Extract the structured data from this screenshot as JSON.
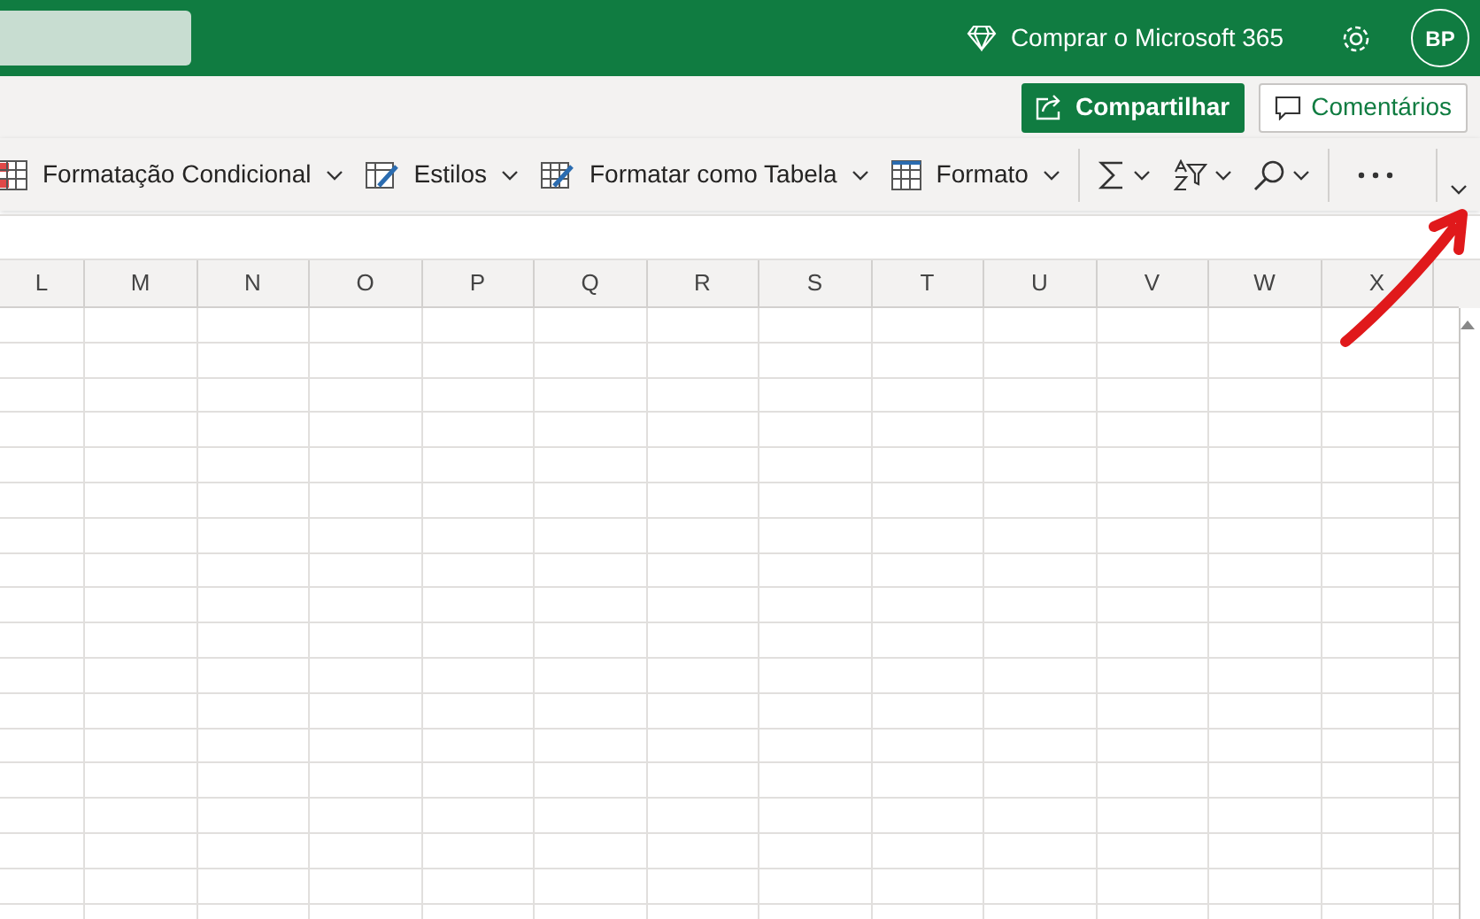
{
  "top_bar": {
    "buy_label": "Comprar o Microsoft 365",
    "avatar_initials": "BP"
  },
  "actions": {
    "share": "Compartilhar",
    "comments": "Comentários"
  },
  "ribbon": [
    {
      "kind": "labeled",
      "label": "Formatação Condicional"
    },
    {
      "kind": "labeled",
      "label": "Estilos"
    },
    {
      "kind": "labeled",
      "label": "Formatar como Tabela"
    },
    {
      "kind": "labeled",
      "label": "Formato"
    },
    {
      "kind": "iconic"
    },
    {
      "kind": "iconic"
    },
    {
      "kind": "iconic"
    },
    {
      "kind": "more"
    }
  ],
  "columns": [
    "L",
    "M",
    "N",
    "O",
    "P",
    "Q",
    "R",
    "S",
    "T",
    "U",
    "V",
    "W",
    "X"
  ]
}
